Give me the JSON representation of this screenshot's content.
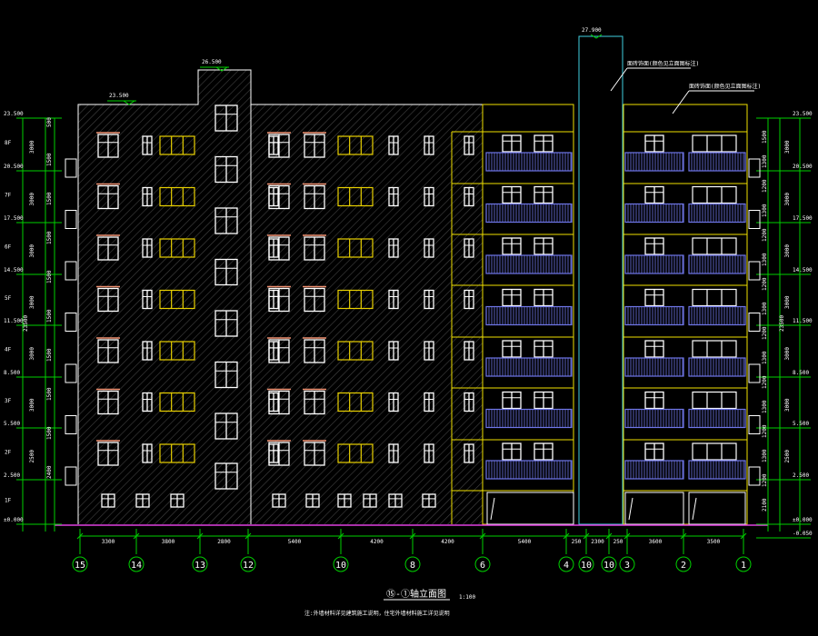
{
  "colors": {
    "background": "#000000",
    "hatch": "#7a7a7a",
    "outline": "#ffffff",
    "floor_lines": "#f0e000",
    "window_frames": "#ffffff",
    "window_yellow": "#e8d000",
    "window_heads": "#f09070",
    "railings": "#6f76e8",
    "shaft": "#40d0e0",
    "dimension_lines": "#00d000",
    "axis_bubbles": "#00d000",
    "ground_line": "#e040e0"
  },
  "drawing": {
    "title": "⑮-①轴立面图",
    "scale": "1:100",
    "note": "注:外墙材料详见建筑施工说明，住宅外墙材料施工详见说明",
    "roof_elevations": [
      "23.500",
      "26.500",
      "25.300",
      "27.900"
    ],
    "callouts": [
      "面砖饰面(颜色见立面图标注)",
      "面砖饰面(颜色见立面图标注)"
    ]
  },
  "axes": [
    "15",
    "14",
    "13",
    "12",
    "10",
    "8",
    "6",
    "4",
    "10",
    "10",
    "3",
    "2",
    "1"
  ],
  "bay_dimensions": [
    "3300",
    "3800",
    "2800",
    "5400",
    "4200",
    "4200",
    "5400",
    "250",
    "2300",
    "250",
    "3600",
    "3500"
  ],
  "left_elevations": [
    "23.500",
    "20.500",
    "17.500",
    "14.500",
    "11.500",
    "8.500",
    "5.500",
    "2.500",
    "±0.000"
  ],
  "right_elevations": [
    "23.500",
    "20.500",
    "17.500",
    "14.500",
    "11.500",
    "8.500",
    "5.500",
    "2.500",
    "±0.000",
    "-0.050"
  ],
  "floor_labels": [
    "8F",
    "7F",
    "6F",
    "5F",
    "4F",
    "3F",
    "2F",
    "1F"
  ],
  "total_height": "23500",
  "left_segments": [
    "500",
    "1500",
    "1500",
    "1500",
    "1500",
    "1500",
    "1500",
    "1500",
    "1500",
    "2400",
    "900",
    "150"
  ],
  "right_segments": [
    "1500",
    "1300",
    "1200",
    "1300",
    "1200",
    "1300",
    "1200",
    "1300",
    "1200",
    "1300",
    "1200",
    "1300",
    "1200",
    "1300",
    "1200",
    "2100",
    "900",
    "150"
  ],
  "outer_left_dims": [
    "3000",
    "3000",
    "3000",
    "3000",
    "3000",
    "3000",
    "2500"
  ],
  "outer_right_dims": [
    "3000",
    "3000",
    "3000",
    "3000",
    "3000",
    "3000",
    "2500"
  ]
}
